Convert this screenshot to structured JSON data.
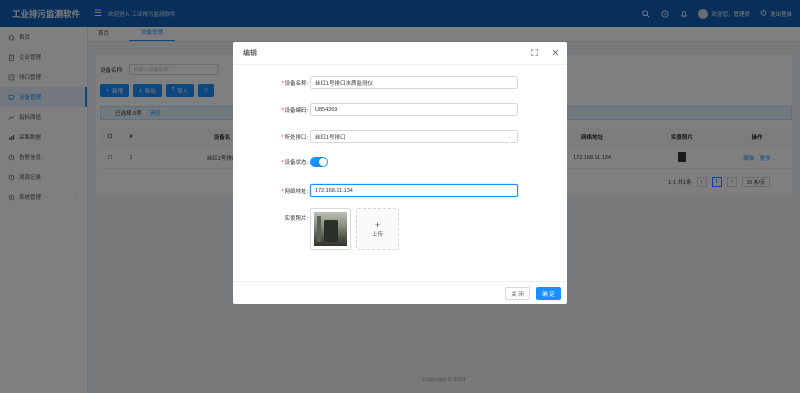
{
  "app": {
    "title": "工业排污监测软件",
    "welcome": "欢迎进入 工业排污监测软件",
    "user_greeting": "欢迎您，管理员",
    "logout": "退出登录"
  },
  "sidebar": {
    "items": [
      {
        "label": "首页",
        "icon": "home-icon"
      },
      {
        "label": "企业管理",
        "icon": "building-icon"
      },
      {
        "label": "排口管理",
        "icon": "outlet-icon"
      },
      {
        "label": "设备管理",
        "icon": "device-icon",
        "active": true
      },
      {
        "label": "指标阈值",
        "icon": "threshold-icon"
      },
      {
        "label": "采集数据",
        "icon": "data-icon"
      },
      {
        "label": "告警信息",
        "icon": "alarm-icon"
      },
      {
        "label": "溯源记录",
        "icon": "trace-icon"
      },
      {
        "label": "系统管理",
        "icon": "settings-icon",
        "has_children": true
      }
    ]
  },
  "tabs": [
    {
      "label": "首页"
    },
    {
      "label": "设备管理",
      "active": true
    }
  ],
  "search": {
    "label": "设备名称:",
    "placeholder": "请输入设备名称"
  },
  "toolbar": {
    "add": "新增",
    "export": "导出",
    "import": "导入"
  },
  "selection": {
    "text": "已选择 0项",
    "clear": "清空"
  },
  "table": {
    "headers": {
      "index": "#",
      "name": "设备名",
      "ip": "网络地址",
      "photo": "实景照片",
      "ops": "操作"
    },
    "rows": [
      {
        "index": "1",
        "name": "丝红1号排口",
        "ip": "172.168.11.134",
        "edit": "编辑",
        "more": "更多"
      }
    ]
  },
  "pagination": {
    "summary": "1-1 共1条",
    "current": "1",
    "page_size": "10 条/页"
  },
  "footer": "Copyright © 2024",
  "modal": {
    "title": "编辑",
    "fields": {
      "device_name": {
        "label": "设备名称:",
        "value": "丝红1号排口水质监测仪"
      },
      "device_code": {
        "label": "设备编码:",
        "value": "U854369"
      },
      "outlet": {
        "label": "所处排口:",
        "value": "丝红1号排口"
      },
      "status": {
        "label": "设备状态:",
        "on": true
      },
      "ip": {
        "label": "网络地址:",
        "value": "172.168.11.134"
      },
      "photo": {
        "label": "实景照片:",
        "upload_label": "上传"
      }
    },
    "close_label": "关 闭",
    "ok_label": "确 定"
  },
  "colors": {
    "brand": "#0f5eb5",
    "primary": "#1890ff",
    "required": "#f5222d"
  }
}
